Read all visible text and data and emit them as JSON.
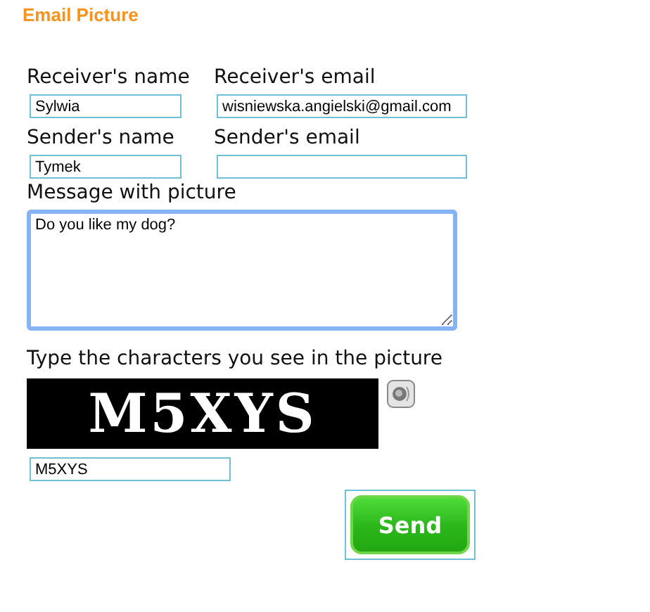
{
  "title": "Email Picture",
  "fields": [
    {
      "label": "Receiver's name",
      "value": "Sylwia"
    },
    {
      "label": "Receiver's email",
      "value": "wisniewska.angielski@gmail.com"
    },
    {
      "label": "Sender's name",
      "value": "Tymek"
    },
    {
      "label": "Sender's email"
    }
  ],
  "message": {
    "label": "Message with picture",
    "value": "Do you like my dog?"
  },
  "captcha": {
    "label": "Type the characters you see in the picture",
    "image_text": "M5XYS",
    "value": "M5XYS"
  },
  "send_button": "Send"
}
